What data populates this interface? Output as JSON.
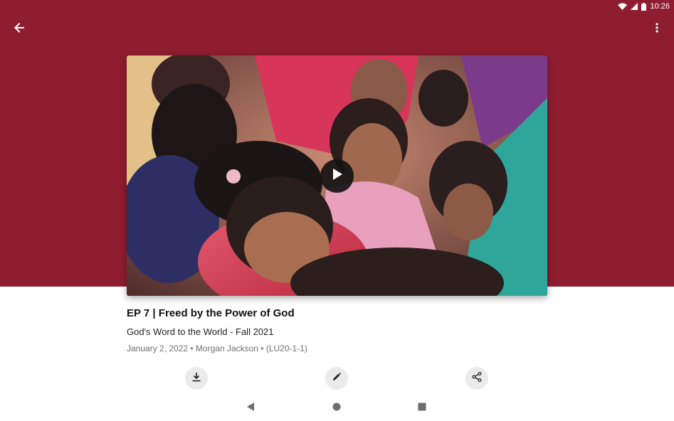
{
  "theme": {
    "hero_color": "#8f1d30",
    "text_dark": "#111111",
    "meta_color": "#6f6f6f",
    "button_bg": "#ebebeb"
  },
  "status_bar": {
    "time": "10:26",
    "icons": [
      "wifi-icon",
      "signal-icon",
      "battery-icon"
    ]
  },
  "app_bar": {
    "back_icon": "arrow-back-icon",
    "menu_icon": "more-vert-icon"
  },
  "video": {
    "play_icon": "play-icon"
  },
  "episode": {
    "title": "EP 7 | Freed by the Power of God",
    "series": "God's Word to the World - Fall 2021",
    "meta": "January 2, 2022 • Morgan Jackson • (LU20-1-1)"
  },
  "actions": [
    {
      "icon": "download-icon"
    },
    {
      "icon": "edit-icon"
    },
    {
      "icon": "share-icon"
    }
  ],
  "nav_bar": {
    "icons": [
      "nav-back-icon",
      "nav-home-icon",
      "nav-recents-icon"
    ]
  }
}
